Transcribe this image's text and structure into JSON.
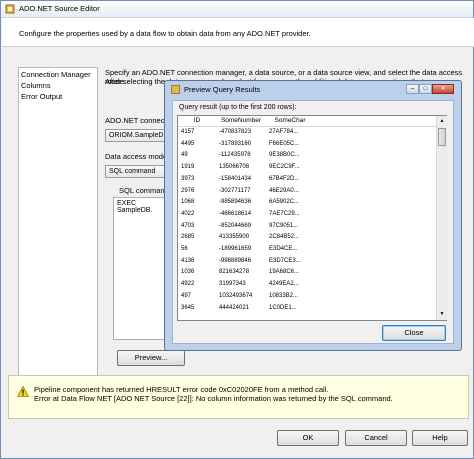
{
  "window": {
    "title": "ADO.NET Source Editor",
    "header_text": "Configure the properties used by a data flow to obtain data from any ADO.NET provider."
  },
  "nav": {
    "items": [
      "Connection Manager",
      "Columns",
      "Error Output"
    ]
  },
  "panel": {
    "description_line1": "Specify an ADO.NET connection manager, a data source, or a data source view, and select the data access mode.",
    "description_line2": "After selecting the data access mode, select from among the additional data access options that appear.",
    "connection_label": "ADO.NET connection",
    "connection_value": "ORIOM.SampleDB.N",
    "access_mode_label": "Data access mode:",
    "access_mode_value": "SQL command",
    "sql_label": "SQL command te",
    "sql_value": "EXEC SampleDB.",
    "preview_button": "Preview..."
  },
  "warning": {
    "line1": "Pipeline component has returned HRESULT error code 0xC02020FE from a method call.",
    "line2": "Error at Data Flow NET [ADO NET Source [22]]: No column information was returned by the SQL command."
  },
  "footer": {
    "ok": "OK",
    "cancel": "Cancel",
    "help": "Help"
  },
  "preview_dialog": {
    "title": "Preview Query Results",
    "result_label": "Query result (up to the first 200 rows):",
    "close_button": "Close",
    "columns": [
      "ID",
      "SomeNumber",
      "SomeChar"
    ],
    "rows": [
      [
        "4157",
        "-470837823",
        "27AF784..."
      ],
      [
        "4495",
        "-317893160",
        "F66E05C..."
      ],
      [
        "49",
        "-112435978",
        "9E38B0C..."
      ],
      [
        "1919",
        "135066708",
        "9EC2C9F..."
      ],
      [
        "3973",
        "-158401434",
        "67B4F2D..."
      ],
      [
        "2976",
        "-302771177",
        "46E29A0..."
      ],
      [
        "1068",
        "-985894636",
        "6A5902C..."
      ],
      [
        "4022",
        "-466618614",
        "7AE7C29..."
      ],
      [
        "4703",
        "-852044669",
        "97C9051..."
      ],
      [
        "2685",
        "413355900",
        "2C84B52..."
      ],
      [
        "56",
        "-189961659",
        "E3D4CE..."
      ],
      [
        "4136",
        "-998889846",
        "E3D7CE3..."
      ],
      [
        "1036",
        "821634278",
        "19A68C6..."
      ],
      [
        "4922",
        "31997343",
        "4249EA2..."
      ],
      [
        "497",
        "1032493674",
        "10833B2..."
      ],
      [
        "3645",
        "444424021",
        "1C0DE1..."
      ]
    ]
  }
}
